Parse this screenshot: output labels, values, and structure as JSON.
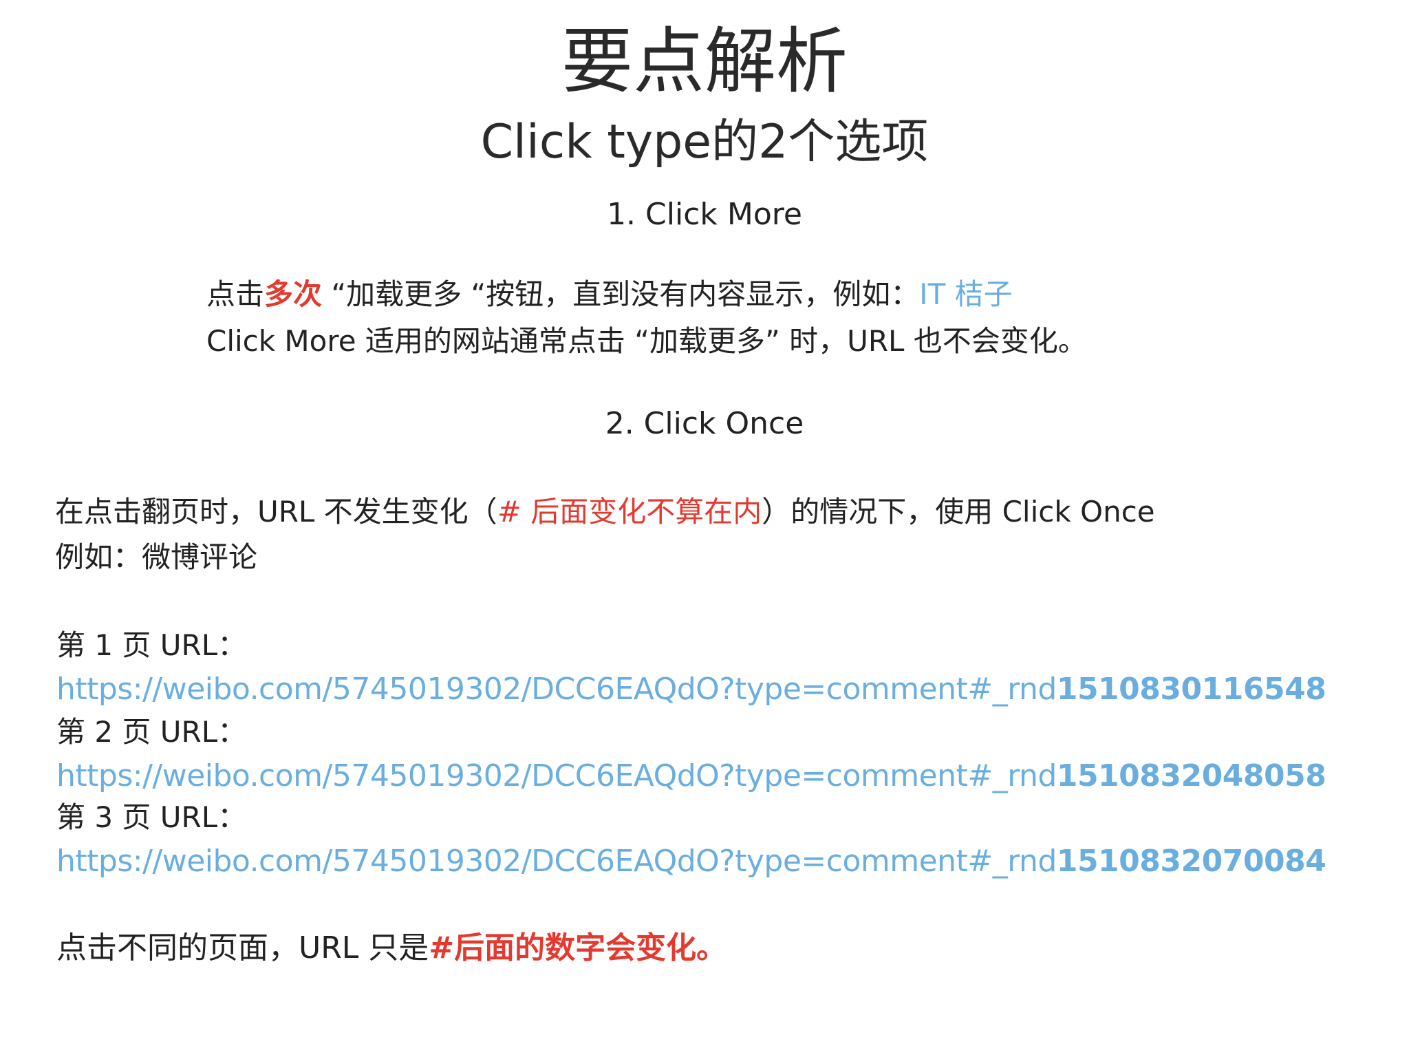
{
  "title": "要点解析",
  "subtitle": "Click type的2个选项",
  "colors": {
    "highlight_red": "#e33a2f",
    "link_blue": "#6aaee0",
    "text": "#222222"
  },
  "click_more": {
    "heading": "1. Click More",
    "line1_prefix": "点击",
    "line1_emphasis": "多次",
    "line1_mid": " “加载更多 “按钮，直到没有内容显示，例如：",
    "line1_link": "IT 桔子",
    "line2": "Click More 适用的网站通常点击 “加载更多” 时，URL 也不会变化。"
  },
  "click_once": {
    "heading": "2. Click Once",
    "line1_prefix": "在点击翻页时，URL 不发生变化（",
    "line1_emphasis": "# 后面变化不算在内",
    "line1_suffix": "）的情况下，使用 Click Once",
    "line2": "例如：微博评论"
  },
  "pages": [
    {
      "label": "第 1 页 URL：",
      "url_base": "https://weibo.com/5745019302/DCC6EAQdO?type=comment#_rnd",
      "url_number": "1510830116548"
    },
    {
      "label": "第 2 页 URL：",
      "url_base": "https://weibo.com/5745019302/DCC6EAQdO?type=comment#_rnd",
      "url_number": "1510832048058"
    },
    {
      "label": "第 3 页 URL：",
      "url_base": "https://weibo.com/5745019302/DCC6EAQdO?type=comment#_rnd",
      "url_number": "1510832070084"
    }
  ],
  "conclusion": {
    "prefix": "点击不同的页面，URL 只是",
    "emphasis": "#后面的数字会变化。"
  }
}
